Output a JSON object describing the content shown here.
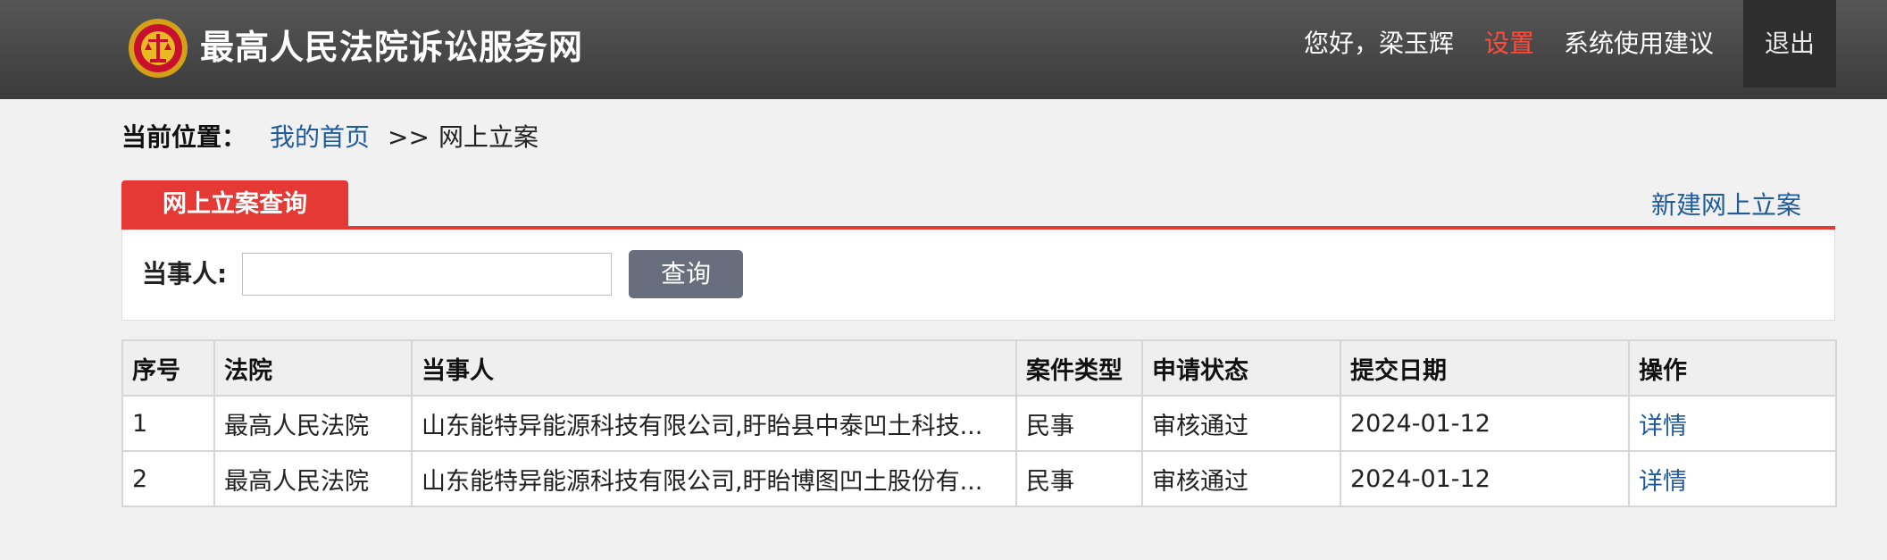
{
  "header": {
    "site_title": "最高人民法院诉讼服务网",
    "greeting": "您好，梁玉辉",
    "settings": "设置",
    "suggestion": "系统使用建议",
    "logout": "退出"
  },
  "breadcrumb": {
    "label": "当前位置：",
    "home": "我的首页",
    "separator": ">>",
    "current": "网上立案"
  },
  "tabs": {
    "active": "网上立案查询",
    "new_case": "新建网上立案"
  },
  "search": {
    "party_label": "当事人:",
    "party_value": "",
    "button": "查询"
  },
  "table": {
    "headers": [
      "序号",
      "法院",
      "当事人",
      "案件类型",
      "申请状态",
      "提交日期",
      "操作"
    ],
    "rows": [
      {
        "no": "1",
        "court": "最高人民法院",
        "party": "山东能特异能源科技有限公司,盱眙县中泰凹土科技...",
        "type": "民事",
        "status": "审核通过",
        "date": "2024-01-12",
        "action": "详情"
      },
      {
        "no": "2",
        "court": "最高人民法院",
        "party": "山东能特异能源科技有限公司,盱眙博图凹土股份有...",
        "type": "民事",
        "status": "审核通过",
        "date": "2024-01-12",
        "action": "详情"
      }
    ]
  },
  "colors": {
    "accent_red": "#e53935",
    "link_blue": "#1f5b9c",
    "header_dark": "#3b3b3b",
    "button_gray": "#686e7d"
  },
  "icons": {
    "logo": "court-emblem-icon"
  }
}
